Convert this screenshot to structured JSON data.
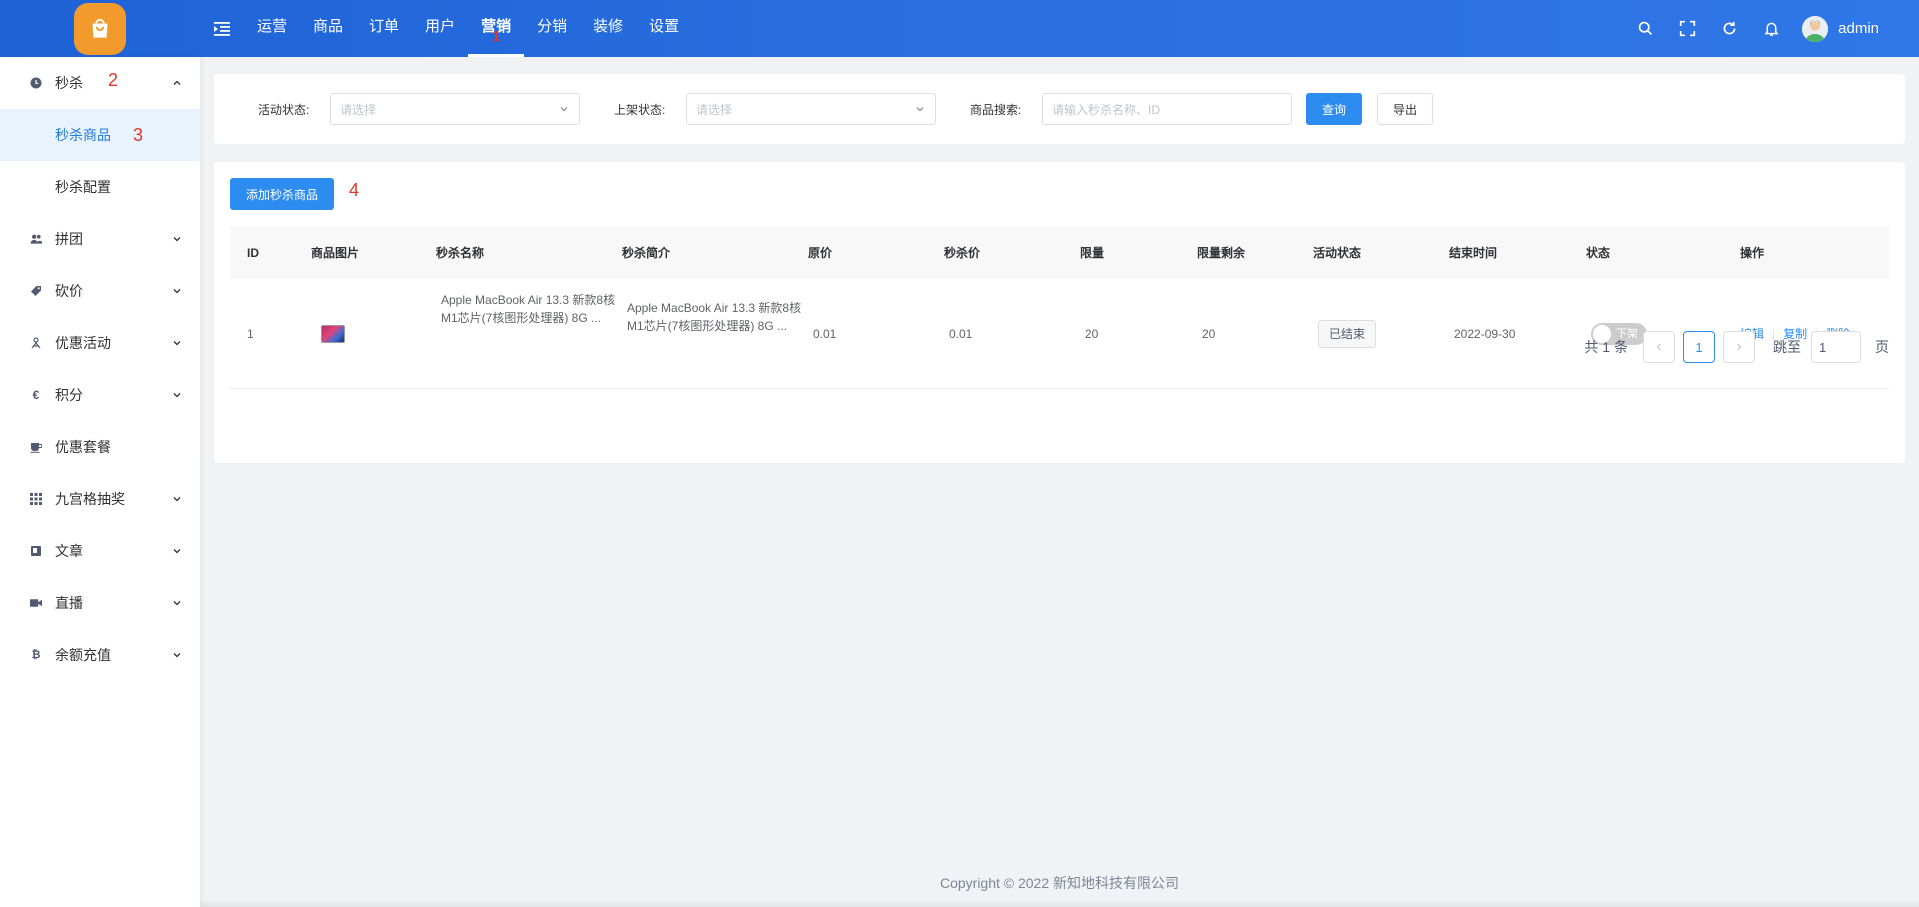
{
  "header": {
    "nav": [
      {
        "label": "运营"
      },
      {
        "label": "商品"
      },
      {
        "label": "订单"
      },
      {
        "label": "用户"
      },
      {
        "label": "营销",
        "annotation": "1"
      },
      {
        "label": "分销"
      },
      {
        "label": "装修"
      },
      {
        "label": "设置"
      }
    ],
    "active_nav": "营销",
    "icons": [
      "search-icon",
      "fullscreen-icon",
      "refresh-icon",
      "bell-icon"
    ],
    "username": "admin"
  },
  "sidebar": {
    "items": [
      {
        "label": "秒杀",
        "icon": "clock-icon",
        "annotation": "2",
        "expanded": true,
        "children": [
          {
            "label": "秒杀商品",
            "annotation": "3",
            "active": true
          },
          {
            "label": "秒杀配置"
          }
        ]
      },
      {
        "label": "拼团",
        "icon": "group-icon"
      },
      {
        "label": "砍价",
        "icon": "tag-icon"
      },
      {
        "label": "优惠活动",
        "icon": "gift-icon"
      },
      {
        "label": "积分",
        "icon": "euro-icon"
      },
      {
        "label": "优惠套餐",
        "icon": "cup-icon"
      },
      {
        "label": "九宫格抽奖",
        "icon": "grid-icon"
      },
      {
        "label": "文章",
        "icon": "book-icon"
      },
      {
        "label": "直播",
        "icon": "video-icon"
      },
      {
        "label": "余额充值",
        "icon": "bitcoin-icon"
      }
    ]
  },
  "filters": {
    "activity_status_label": "活动状态:",
    "activity_status_placeholder": "请选择",
    "shelf_status_label": "上架状态:",
    "shelf_status_placeholder": "请选择",
    "search_label": "商品搜索:",
    "search_placeholder": "请输入秒杀名称、ID",
    "query_button": "查询",
    "export_button": "导出"
  },
  "toolbar": {
    "add_button": "添加秒杀商品",
    "add_annotation": "4"
  },
  "table": {
    "columns": [
      "ID",
      "商品图片",
      "秒杀名称",
      "秒杀简介",
      "原价",
      "秒杀价",
      "限量",
      "限量剩余",
      "活动状态",
      "结束时间",
      "状态",
      "操作"
    ],
    "rows": [
      {
        "id": "1",
        "name": "Apple MacBook Air 13.3 新款8核M1芯片(7核图形处理器) 8G ...",
        "intro": "Apple MacBook Air 13.3 新款8核M1芯片(7核图形处理器) 8G ...",
        "original_price": "0.01",
        "seckill_price": "0.01",
        "limit": "20",
        "limit_remaining": "20",
        "activity_status": "已结束",
        "end_time": "2022-09-30",
        "status_label": "下架",
        "status_on": false,
        "actions": [
          "编辑",
          "复制",
          "删除"
        ]
      }
    ]
  },
  "pagination": {
    "total": "共 1 条",
    "current_page": "1",
    "jump_label": "跳至",
    "jump_value": "1",
    "page_suffix": "页"
  },
  "footer": {
    "copyright": "Copyright © 2022 新知地科技有限公司"
  },
  "colors": {
    "header_gradient_start": "#1e63d6",
    "header_gradient_end": "#2f76e6",
    "primary": "#2d8cf0",
    "logo": "#f39a2d",
    "annotation": "#e0352b"
  }
}
